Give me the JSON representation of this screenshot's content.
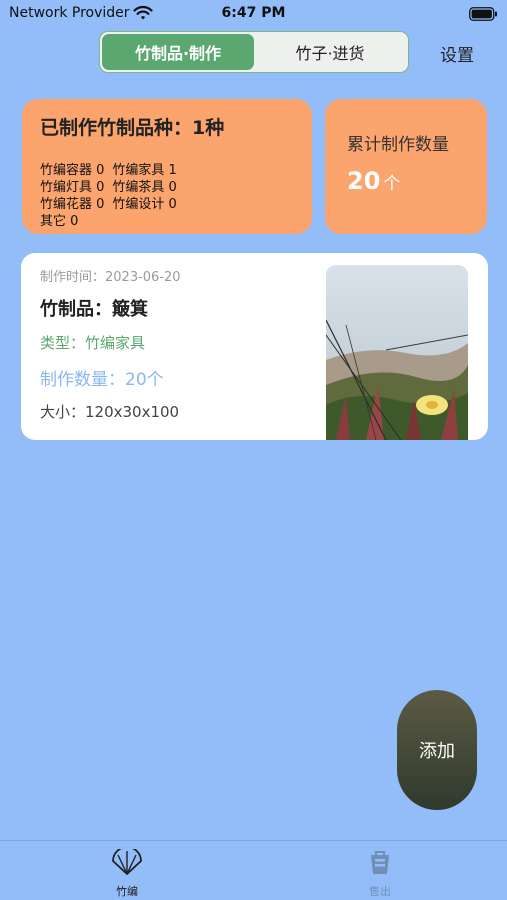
{
  "status_bar": {
    "carrier": "Network Provider",
    "time": "6:47 PM"
  },
  "header": {
    "tabs": [
      {
        "label": "竹制品·制作",
        "active": true
      },
      {
        "label": "竹子·进货",
        "active": false
      }
    ],
    "settings_label": "设置"
  },
  "summary": {
    "title": "已制作竹制品种：1种",
    "categories": [
      "竹编容器 0",
      "竹编家具 1",
      "竹编灯具 0",
      "竹编茶具 0",
      "竹编花器 0",
      "竹编设计 0",
      "其它 0"
    ],
    "total_label": "累计制作数量",
    "total_value": "20",
    "total_unit": "个"
  },
  "item": {
    "time": "制作时间：2023-06-20",
    "name": "竹制品：簸箕",
    "type": "类型：竹编家具",
    "quantity": "制作数量：20个",
    "size": "大小：120x30x100"
  },
  "add_button_label": "添加",
  "tab_bar": {
    "items": [
      {
        "label": "竹编",
        "icon": "fan-icon",
        "active": true
      },
      {
        "label": "售出",
        "icon": "bag-icon",
        "active": false
      }
    ]
  },
  "colors": {
    "background": "#93bdf9",
    "accent_green": "#5aa870",
    "card_orange": "#fba46d",
    "quantity_blue": "#8ab7ee"
  }
}
